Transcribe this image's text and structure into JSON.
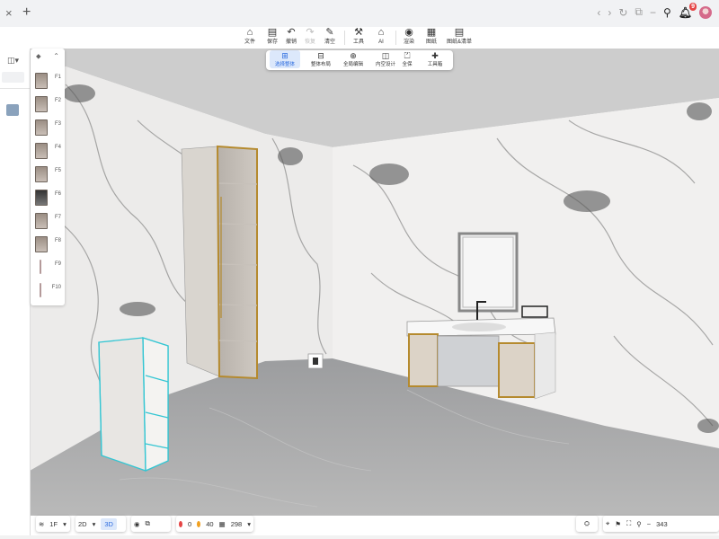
{
  "titlebar": {
    "close_icon": "×",
    "new_tab_icon": "+",
    "notification_count": "9"
  },
  "toolbar": {
    "items": [
      {
        "icon": "⌂",
        "label": "文件"
      },
      {
        "icon": "▤",
        "label": "保存"
      },
      {
        "icon": "↶",
        "label": "撤销"
      },
      {
        "icon": "↷",
        "label": "恢复"
      },
      {
        "icon": "✎",
        "label": "清空"
      },
      {
        "icon": "⚒",
        "label": "工具"
      },
      {
        "icon": "⌂",
        "label": "AI"
      },
      {
        "icon": "◉",
        "label": "渲染"
      },
      {
        "icon": "▦",
        "label": "图纸"
      },
      {
        "icon": "▤",
        "label": "图纸&清单"
      }
    ]
  },
  "subbar": {
    "items": [
      {
        "icon": "⊞",
        "label": "选择整体"
      },
      {
        "icon": "⊟",
        "label": "整体布局"
      },
      {
        "icon": "⊕",
        "label": "全局编辑"
      },
      {
        "icon": "◫",
        "label": "内空设计"
      },
      {
        "icon": "⏍",
        "label": "全保"
      },
      {
        "icon": "✚",
        "label": "工具箱"
      }
    ]
  },
  "floorlist": {
    "items": [
      {
        "label": "F1"
      },
      {
        "label": "F2"
      },
      {
        "label": "F3"
      },
      {
        "label": "F4"
      },
      {
        "label": "F5"
      },
      {
        "label": "F6"
      },
      {
        "label": "F7"
      },
      {
        "label": "F8"
      },
      {
        "label": "F9"
      },
      {
        "label": "F10"
      }
    ]
  },
  "bottombar": {
    "floor": "1F",
    "view2d": "2D",
    "view3d": "3D",
    "errors": "0",
    "warnings": "40",
    "count": "298",
    "zoom": "343"
  },
  "colors": {
    "accent": "#2d6cdf",
    "selection": "#34c6d3",
    "cabinet_frame": "#b58a2e",
    "error": "#e54545",
    "warning": "#f0a020"
  }
}
